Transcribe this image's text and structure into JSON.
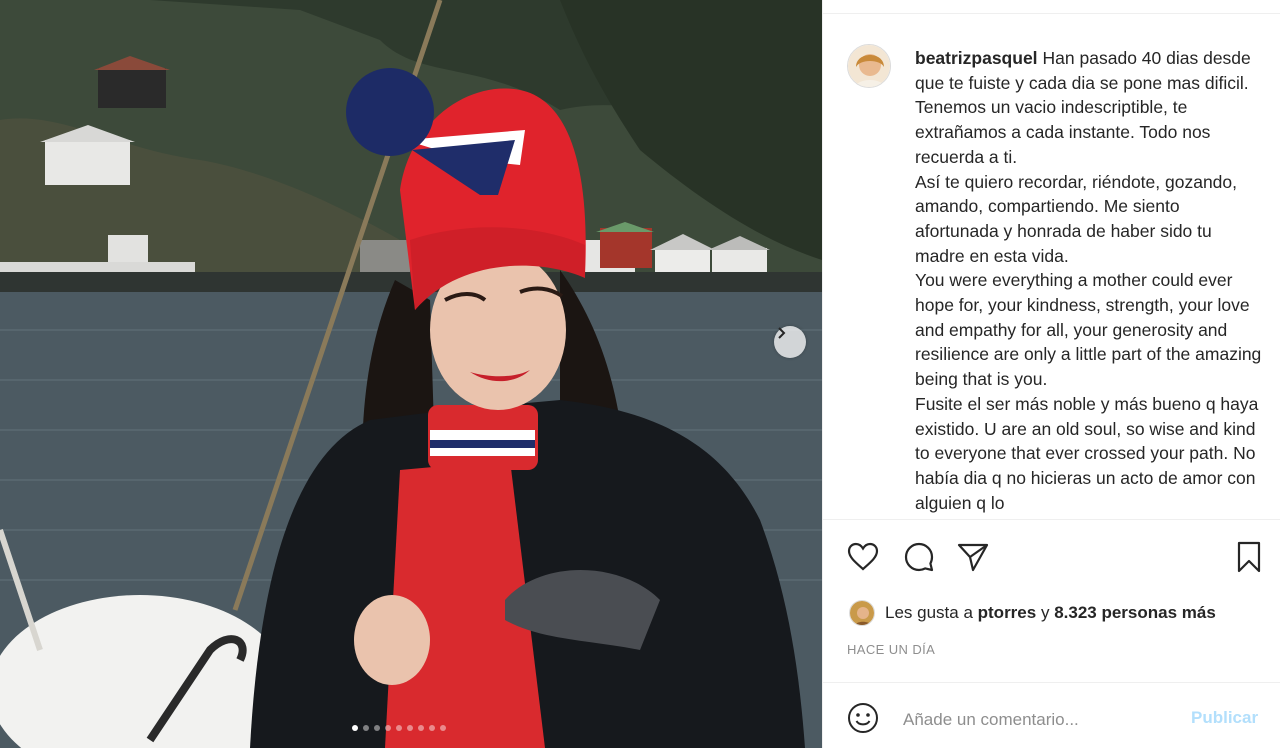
{
  "post": {
    "username": "beatrizpasquel",
    "caption_lines": [
      "Han pasado 40 dias desde que te fuiste y cada dia se pone mas dificil. Tenemos un vacio indescriptible, te extrañamos a cada instante. Todo nos recuerda a ti.",
      "Así te quiero recordar, riéndote, gozando, amando, compartiendo. Me siento afortunada y honrada de haber sido tu madre en esta vida.",
      "You were everything a mother could ever hope for, your kindness, strength, your love and empathy for all, your generosity and resilience are only a little part of the amazing being that is you.",
      "Fusite el ser más noble y más bueno q haya existido. U are an old soul, so wise and kind to everyone that ever crossed your path. No había dia q no hicieras un acto de amor con alguien q lo"
    ],
    "likes_prefix": "Les gusta a",
    "likes_user": "ptorres",
    "likes_joiner": "y",
    "likes_count": "8.323 personas más",
    "timestamp": "HACE UN DÍA"
  },
  "carousel": {
    "slide_count": 9,
    "active_index": 0
  },
  "comment": {
    "placeholder": "Añade un comentario...",
    "publish_label": "Publicar"
  },
  "icons": {
    "like": "heart-icon",
    "comment": "comment-icon",
    "share": "paper-plane-icon",
    "save": "bookmark-icon",
    "emoji": "smiley-icon",
    "next": "chevron-right-icon"
  },
  "colors": {
    "text": "#262626",
    "muted": "#8e8e8e",
    "publish_disabled": "#b2dffc",
    "divider": "#efefef"
  }
}
